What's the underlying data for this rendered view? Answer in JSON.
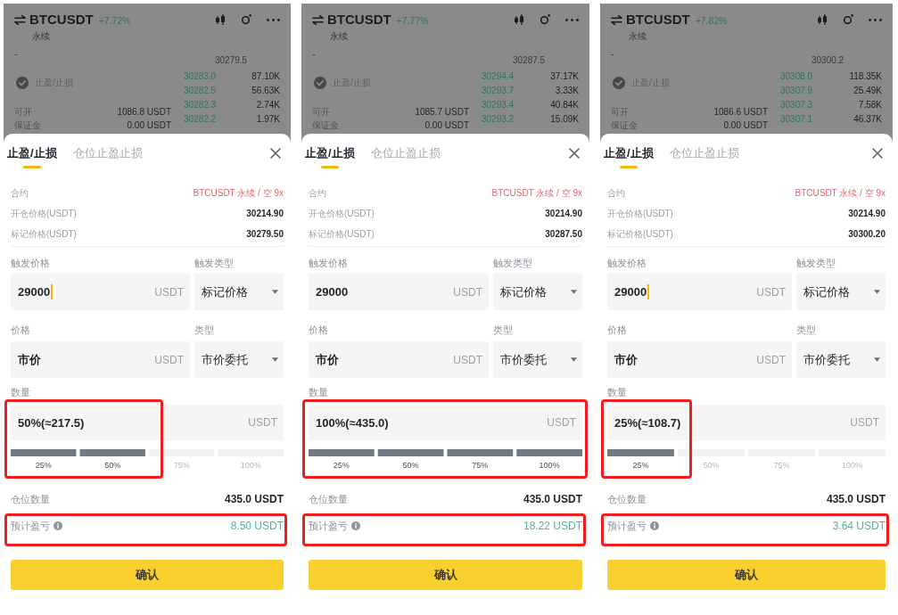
{
  "panels": [
    {
      "header": {
        "symbol": "BTCUSDT",
        "change": "+7.72%",
        "contract_type": "永续"
      },
      "unlabeled_value": "-",
      "mark_price": "30279.5",
      "tpsl_toggle": {
        "label": "止盈/止损",
        "checked": true
      },
      "order_book": [
        {
          "price": "30283.0",
          "amount": "87.10K"
        },
        {
          "price": "30282.5",
          "amount": "56.63K"
        },
        {
          "price": "30282.3",
          "amount": "2.74K"
        },
        {
          "price": "30282.2",
          "amount": "1.97K"
        }
      ],
      "account": [
        {
          "label": "可开",
          "value": "1086.8 USDT"
        },
        {
          "label": "保证金",
          "value": "0.00 USDT"
        }
      ],
      "sheet": {
        "tabs": [
          {
            "label": "止盈/止损",
            "selected": true
          },
          {
            "label": "仓位止盈止损",
            "selected": false
          }
        ],
        "details": [
          {
            "kind": "contract",
            "label": "合约",
            "value": "BTCUSDT 永续 / 空 9x"
          },
          {
            "kind": "price",
            "label": "开仓价格(USDT)",
            "value": "30214.90"
          },
          {
            "kind": "price",
            "label": "标记价格(USDT)",
            "value": "30279.50"
          }
        ],
        "trigger_price": {
          "label": "触发价格",
          "value": "29000",
          "unit": "USDT",
          "focused": true
        },
        "trigger_type": {
          "label": "触发类型",
          "value": "标记价格"
        },
        "price": {
          "label": "价格",
          "value": "市价",
          "unit": "USDT"
        },
        "order_type": {
          "label": "类型",
          "value": "市价委托"
        },
        "quantity": {
          "label": "数量",
          "value": "50%(≈217.5)",
          "unit": "USDT",
          "level": 0.5,
          "steps": [
            "25%",
            "50%",
            "75%",
            "100%"
          ],
          "highlighted": true
        },
        "position_size": {
          "label": "仓位数量",
          "value": "435.0 USDT"
        },
        "estimated_pnl": {
          "label": "预计盈亏",
          "value": "8.50 USDT",
          "highlighted": true
        },
        "confirm_button": {
          "label": "确认"
        }
      }
    },
    {
      "header": {
        "symbol": "BTCUSDT",
        "change": "+7.77%",
        "contract_type": "永续"
      },
      "unlabeled_value": "-",
      "mark_price": "30287.5",
      "tpsl_toggle": {
        "label": "止盈/止损",
        "checked": true
      },
      "order_book": [
        {
          "price": "30294.4",
          "amount": "37.17K"
        },
        {
          "price": "30293.7",
          "amount": "3.33K"
        },
        {
          "price": "30293.4",
          "amount": "40.84K"
        },
        {
          "price": "30293.2",
          "amount": "15.09K"
        }
      ],
      "account": [
        {
          "label": "可开",
          "value": "1085.7 USDT"
        },
        {
          "label": "保证金",
          "value": "0.00 USDT"
        }
      ],
      "sheet": {
        "tabs": [
          {
            "label": "止盈/止损",
            "selected": true
          },
          {
            "label": "仓位止盈止损",
            "selected": false
          }
        ],
        "details": [
          {
            "kind": "contract",
            "label": "合约",
            "value": "BTCUSDT 永续 / 空 9x"
          },
          {
            "kind": "price",
            "label": "开仓价格(USDT)",
            "value": "30214.90"
          },
          {
            "kind": "price",
            "label": "标记价格(USDT)",
            "value": "30287.50"
          }
        ],
        "trigger_price": {
          "label": "触发价格",
          "value": "29000",
          "unit": "USDT",
          "focused": false
        },
        "trigger_type": {
          "label": "触发类型",
          "value": "标记价格"
        },
        "price": {
          "label": "价格",
          "value": "市价",
          "unit": "USDT"
        },
        "order_type": {
          "label": "类型",
          "value": "市价委托"
        },
        "quantity": {
          "label": "数量",
          "value": "100%(≈435.0)",
          "unit": "USDT",
          "level": 1,
          "steps": [
            "25%",
            "50%",
            "75%",
            "100%"
          ],
          "highlighted": true
        },
        "position_size": {
          "label": "仓位数量",
          "value": "435.0 USDT"
        },
        "estimated_pnl": {
          "label": "预计盈亏",
          "value": "18.22 USDT",
          "highlighted": true
        },
        "confirm_button": {
          "label": "确认"
        }
      }
    },
    {
      "header": {
        "symbol": "BTCUSDT",
        "change": "+7.82%",
        "contract_type": "永续"
      },
      "unlabeled_value": "-",
      "mark_price": "30300.2",
      "tpsl_toggle": {
        "label": "止盈/止损",
        "checked": true
      },
      "order_book": [
        {
          "price": "30308.0",
          "amount": "118.35K"
        },
        {
          "price": "30307.9",
          "amount": "25.49K"
        },
        {
          "price": "30307.3",
          "amount": "7.58K"
        },
        {
          "price": "30307.1",
          "amount": "46.37K"
        }
      ],
      "account": [
        {
          "label": "可开",
          "value": "1086.6 USDT"
        },
        {
          "label": "保证金",
          "value": "0.00 USDT"
        }
      ],
      "sheet": {
        "tabs": [
          {
            "label": "止盈/止损",
            "selected": true
          },
          {
            "label": "仓位止盈止损",
            "selected": false
          }
        ],
        "details": [
          {
            "kind": "contract",
            "label": "合约",
            "value": "BTCUSDT 永续 / 空 9x"
          },
          {
            "kind": "price",
            "label": "开仓价格(USDT)",
            "value": "30214.90"
          },
          {
            "kind": "price",
            "label": "标记价格(USDT)",
            "value": "30300.20"
          }
        ],
        "trigger_price": {
          "label": "触发价格",
          "value": "29000",
          "unit": "USDT",
          "focused": true
        },
        "trigger_type": {
          "label": "触发类型",
          "value": "标记价格"
        },
        "price": {
          "label": "价格",
          "value": "市价",
          "unit": "USDT"
        },
        "order_type": {
          "label": "类型",
          "value": "市价委托"
        },
        "quantity": {
          "label": "数量",
          "value": "25%(≈108.7)",
          "unit": "USDT",
          "level": 0.25,
          "steps": [
            "25%",
            "50%",
            "75%",
            "100%"
          ],
          "highlighted": true
        },
        "position_size": {
          "label": "仓位数量",
          "value": "435.0 USDT"
        },
        "estimated_pnl": {
          "label": "预计盈亏",
          "value": "3.64 USDT",
          "highlighted": true
        },
        "confirm_button": {
          "label": "确认"
        }
      }
    }
  ]
}
